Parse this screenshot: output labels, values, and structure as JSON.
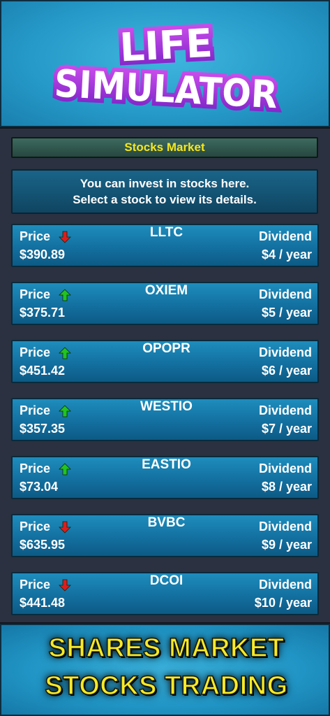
{
  "top_banner": {
    "logo_line1": "LIFE",
    "logo_line2": "SIMULATOR"
  },
  "header": {
    "title": "Stocks Market"
  },
  "info": {
    "line1": "You can invest in stocks here.",
    "line2": "Select a stock to view its details."
  },
  "labels": {
    "price": "Price",
    "dividend": "Dividend"
  },
  "colors": {
    "trend_up": "#22c322",
    "trend_down": "#e01b1b",
    "header_text": "#f5e71c"
  },
  "stocks": [
    {
      "name": "LLTC",
      "price": "$390.89",
      "trend": "down",
      "trend_icon": "arrow-down-icon",
      "dividend": "$4 / year"
    },
    {
      "name": "OXIEM",
      "price": "$375.71",
      "trend": "up",
      "trend_icon": "arrow-up-icon",
      "dividend": "$5 / year"
    },
    {
      "name": "OPOPR",
      "price": "$451.42",
      "trend": "up",
      "trend_icon": "arrow-up-icon",
      "dividend": "$6 / year"
    },
    {
      "name": "WESTIO",
      "price": "$357.35",
      "trend": "up",
      "trend_icon": "arrow-up-icon",
      "dividend": "$7 / year"
    },
    {
      "name": "EASTIO",
      "price": "$73.04",
      "trend": "up",
      "trend_icon": "arrow-up-icon",
      "dividend": "$8 / year"
    },
    {
      "name": "BVBC",
      "price": "$635.95",
      "trend": "down",
      "trend_icon": "arrow-down-icon",
      "dividend": "$9 / year"
    },
    {
      "name": "DCOI",
      "price": "$441.48",
      "trend": "down",
      "trend_icon": "arrow-down-icon",
      "dividend": "$10 / year"
    }
  ],
  "bottom_banner": {
    "line1": "SHARES MARKET",
    "line2": "STOCKS TRADING"
  }
}
